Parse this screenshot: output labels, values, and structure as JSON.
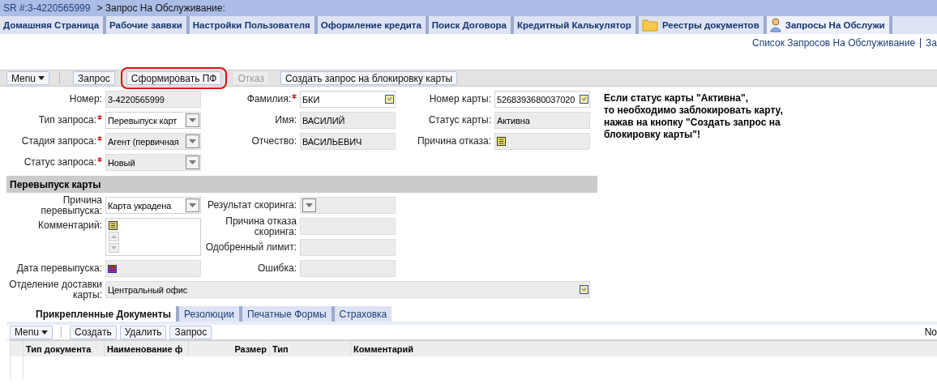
{
  "breadcrumb": {
    "record": "SR #:3-4220565999",
    "title": "> Запрос На Обслуживание:"
  },
  "nav_tabs": [
    {
      "label": "Домашняя Страница",
      "kind": "plain",
      "selected": false
    },
    {
      "label": "Рабочие заявки",
      "kind": "plain",
      "selected": false
    },
    {
      "label": "Настройки Пользователя",
      "kind": "plain",
      "selected": false
    },
    {
      "label": "Оформление кредита",
      "kind": "plain",
      "selected": false
    },
    {
      "label": "Поиск Договора",
      "kind": "plain",
      "selected": false
    },
    {
      "label": "Кредитный Калькулятор",
      "kind": "plain",
      "selected": false
    },
    {
      "label": "Реестры документов",
      "kind": "folder",
      "selected": false
    },
    {
      "label": "Запросы На Обслужи",
      "kind": "person",
      "selected": true
    }
  ],
  "links": [
    "Список Запросов На Обслуживание",
    "За"
  ],
  "toolbar": {
    "menu": "Menu",
    "buttons": [
      {
        "label": "Запрос",
        "disabled": false,
        "highlighted": false
      },
      {
        "label": "Сформировать ПФ",
        "disabled": false,
        "highlighted": true
      },
      {
        "label": "Отказ",
        "disabled": true,
        "highlighted": false
      },
      {
        "label": "Создать запрос на блокировку карты",
        "disabled": false,
        "highlighted": false
      }
    ]
  },
  "form": {
    "columns": [
      [
        {
          "label": "Номер:",
          "value": "3-4220565999",
          "kind": "text",
          "required": false,
          "readonly": true
        },
        {
          "label": "Тип запроса:",
          "value": "Перевыпуск карт",
          "kind": "select",
          "required": true,
          "readonly": false
        },
        {
          "label": "Стадия запроса:",
          "value": "Агент (первичная",
          "kind": "select",
          "required": true,
          "readonly": true
        },
        {
          "label": "Статус запроса:",
          "value": "Новый",
          "kind": "select",
          "required": true,
          "readonly": true
        }
      ],
      [
        {
          "label": "Фамилия:",
          "value": "БКИ",
          "kind": "pick",
          "required": true,
          "readonly": false
        },
        {
          "label": "Имя:",
          "value": "ВАСИЛИЙ",
          "kind": "text",
          "required": false,
          "readonly": true
        },
        {
          "label": "Отчество:",
          "value": "ВАСИЛЬЕВИЧ",
          "kind": "text",
          "required": false,
          "readonly": true
        }
      ],
      [
        {
          "label": "Номер карты:",
          "value": "5268393680037020",
          "kind": "pick",
          "required": false,
          "readonly": false
        },
        {
          "label": "Статус карты:",
          "value": "Активна",
          "kind": "text",
          "required": false,
          "readonly": true
        },
        {
          "label": "Причина отказа:",
          "kind": "memo-line",
          "required": false,
          "readonly": true
        }
      ]
    ],
    "note": "Если статус карты \"Активна\",\nто необходимо заблокировать карту,\nнажав на кнопку \"Создать запрос на\nблокировку карты\"!"
  },
  "section": {
    "title": "Перевыпуск карты",
    "columns": [
      [
        {
          "label": "Причина перевыпуска:",
          "value": "Карта украдена",
          "kind": "select",
          "readonly": false
        },
        {
          "label": "Комментарий:",
          "kind": "memo",
          "readonly": false
        },
        {
          "label": "Дата перевыпуска:",
          "kind": "date",
          "readonly": true
        }
      ],
      [
        {
          "label": "Результат скоринга:",
          "kind": "select",
          "readonly": true
        },
        {
          "label": "Причина отказа скоринга:",
          "kind": "text",
          "readonly": true
        },
        {
          "label": "Одобренный лимит:",
          "kind": "text",
          "readonly": true
        },
        {
          "label": "Ошибка:",
          "kind": "text",
          "readonly": true
        }
      ]
    ],
    "delivery": {
      "label": "Отделение доставки карты:",
      "value": "Центральный офис",
      "kind": "pick",
      "readonly": true
    }
  },
  "sub_tabs": [
    {
      "label": "Прикрепленные Документы",
      "selected": true
    },
    {
      "label": "Резолюции",
      "selected": false
    },
    {
      "label": "Печатные Формы",
      "selected": false
    },
    {
      "label": "Страховка",
      "selected": false
    }
  ],
  "sub_toolbar": {
    "menu": "Menu",
    "buttons": [
      "Создать",
      "Удалить",
      "Запрос"
    ],
    "right_text": "No"
  },
  "table": {
    "columns": [
      {
        "label": "Тип документа",
        "kind": "text"
      },
      {
        "label": "Наименование ф",
        "kind": "text"
      },
      {
        "label": "Размер",
        "kind": "number"
      },
      {
        "label": "Тип",
        "kind": "text"
      },
      {
        "label": "Комментарий",
        "kind": "text"
      }
    ]
  }
}
